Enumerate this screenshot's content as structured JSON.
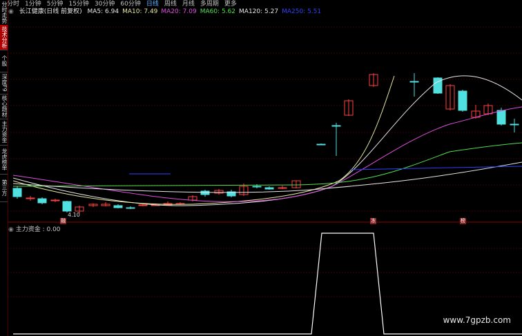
{
  "topbar": {
    "items": [
      "分时",
      "1分钟",
      "5分钟",
      "15分钟",
      "30分钟",
      "60分钟",
      "日线",
      "周线",
      "月线",
      "多周期",
      "更多"
    ],
    "active": "日线"
  },
  "left_tabs": [
    "分时走势",
    "技术分析",
    "个股",
    "深度F9",
    "核心题材",
    "主力资金",
    "龙虎榜单",
    "第三方"
  ],
  "active_left_tab": "技术分析",
  "stock": {
    "name": "长江健康(日线 前复权)",
    "ma": [
      {
        "label": "MA5: 6.94",
        "color": "#e8e8e8"
      },
      {
        "label": "MA10: 7.49",
        "color": "#e8e8a0"
      },
      {
        "label": "MA20: 7.09",
        "color": "#e050e0"
      },
      {
        "label": "MA60: 5.62",
        "color": "#50e050"
      },
      {
        "label": "MA120: 5.27",
        "color": "#e8e8e8"
      },
      {
        "label": "MA250: 5.51",
        "color": "#3040ff"
      }
    ]
  },
  "low_label": "4.10",
  "markers": [
    {
      "text": "融",
      "color": "#8b2020"
    },
    {
      "text": "冻",
      "color": "#8b2020"
    },
    {
      "text": "榜",
      "color": "#8b2020"
    }
  ],
  "indicator": {
    "label": "主力资金 : 0.00"
  },
  "watermark": "www.7gpzb.com",
  "colors": {
    "up": "#ff4040",
    "down": "#50e0e0",
    "grid": "#3a0000"
  }
}
